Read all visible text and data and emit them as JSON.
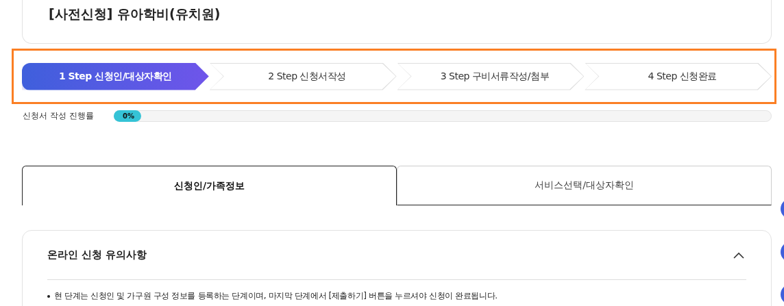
{
  "page_title": "[사전신청] 유아학비(유치원)",
  "steps": [
    {
      "label": "1 Step 신청인/대상자확인",
      "selected": true
    },
    {
      "label": "2 Step 신청서작성",
      "selected": false
    },
    {
      "label": "3 Step 구비서류작성/첨부",
      "selected": false
    },
    {
      "label": "4 Step 신청완료",
      "selected": false
    }
  ],
  "progress": {
    "label": "신청서 작성 진행률",
    "level": 0,
    "reading": "0%"
  },
  "tabs": [
    {
      "label": "신청인/가족정보",
      "selected": true
    },
    {
      "label": "서비스선택/대상자확인",
      "selected": false
    }
  ],
  "notice": {
    "title": "온라인 신청 유의사항",
    "expanded": true,
    "items": [
      "현 단계는 신청인 및 가구원 구성 정보를 등록하는 단계이며, 마지막 단계에서 [제출하기] 버튼을 누르셔야 신청이 완료됩니다."
    ]
  }
}
